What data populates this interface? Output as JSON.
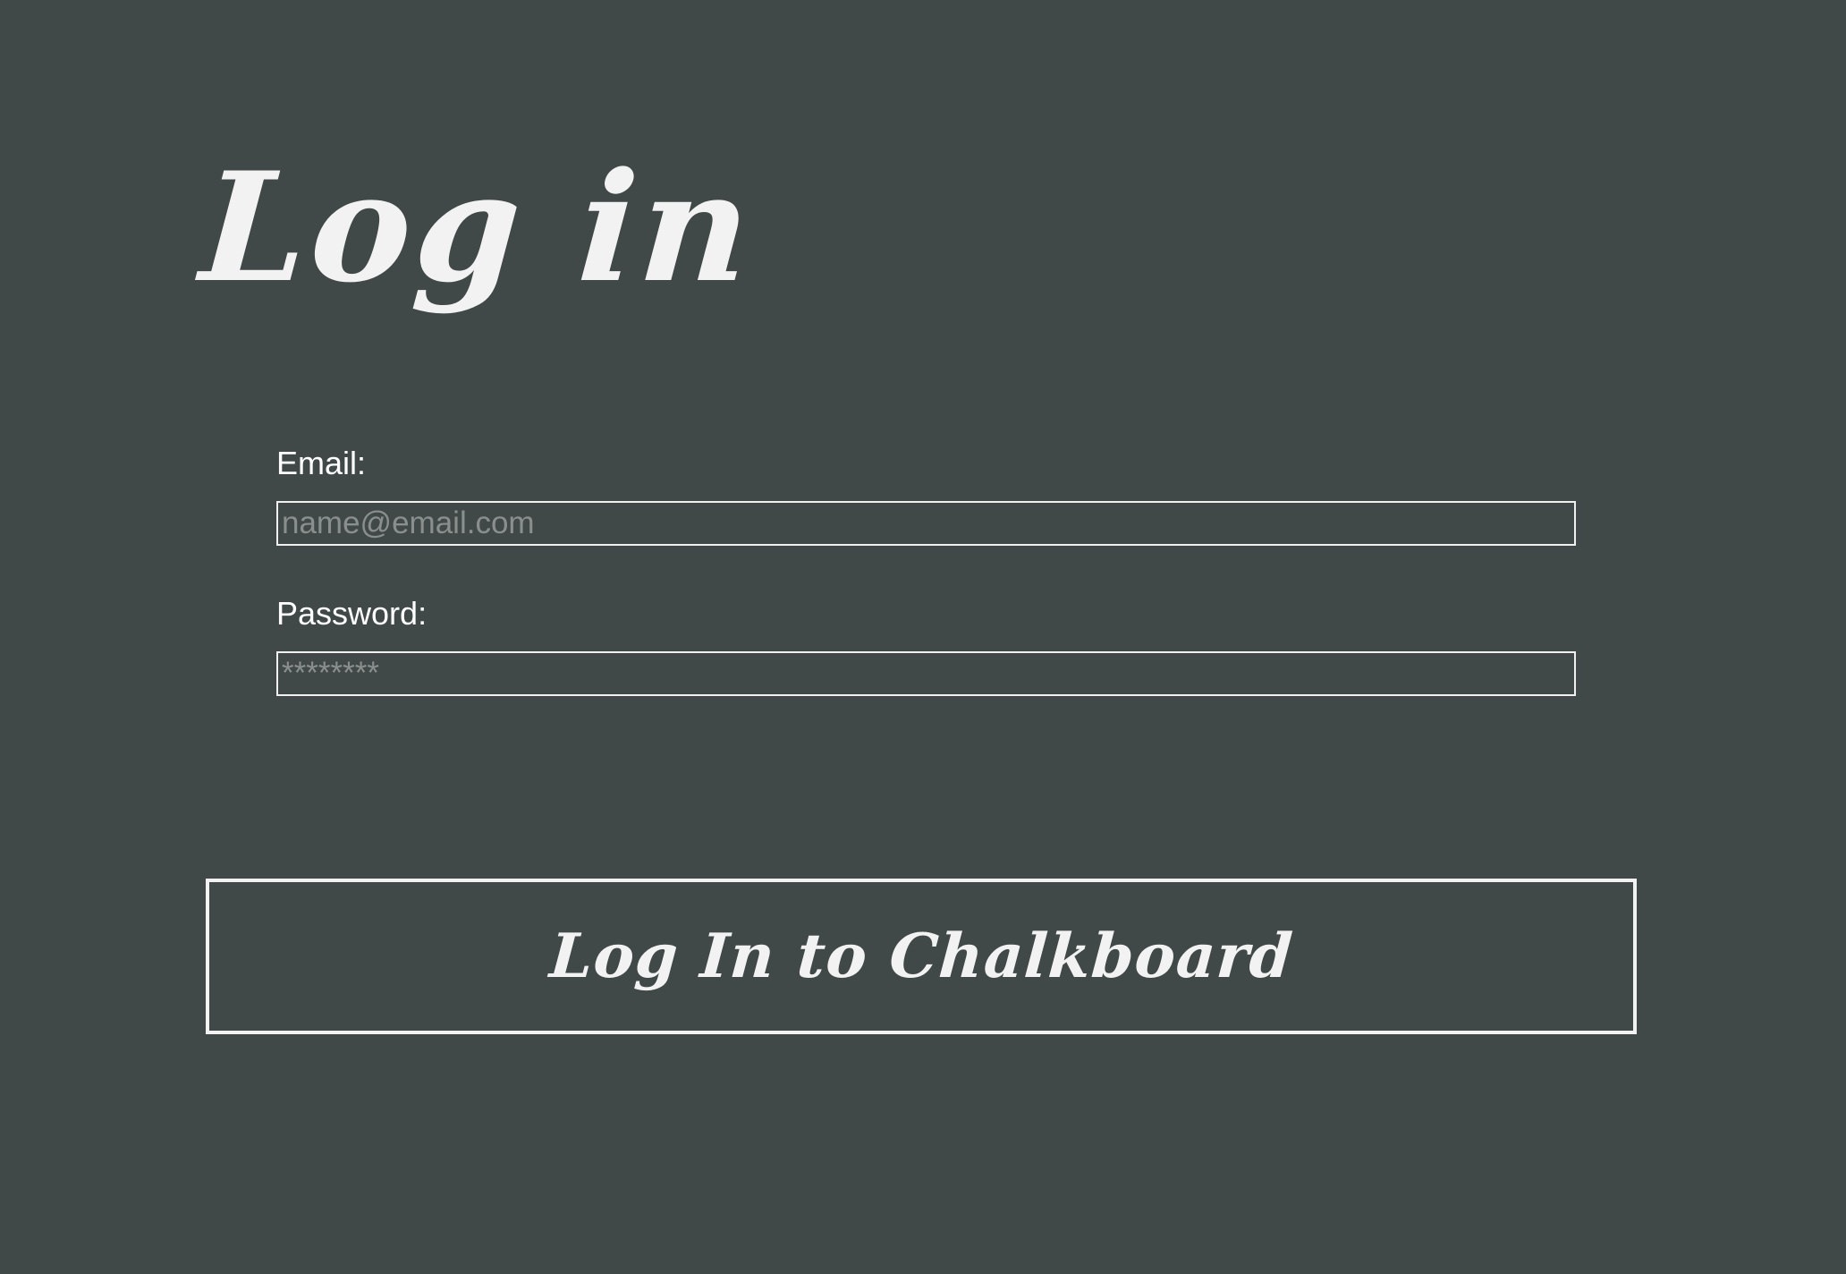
{
  "login": {
    "title": "Log in",
    "email": {
      "label": "Email:",
      "placeholder": "name@email.com"
    },
    "password": {
      "label": "Password:",
      "placeholder": "********"
    },
    "submit_label": "Log In to Chalkboard"
  },
  "colors": {
    "background": "#404947",
    "foreground": "#f2f2f2",
    "placeholder": "#8a8f8d"
  }
}
